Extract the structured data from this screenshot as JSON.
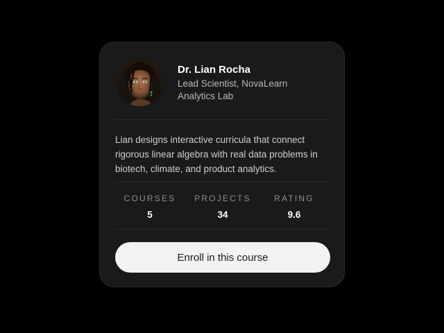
{
  "profile": {
    "name": "Dr. Lian Rocha",
    "role": "Lead Scientist, NovaLearn Analytics Lab",
    "avatar": "avatar-photo"
  },
  "bio": "Lian designs interactive curricula that connect rigorous linear algebra with real data problems in biotech, climate, and product analytics.",
  "stats": [
    {
      "label": "COURSES",
      "value": "5"
    },
    {
      "label": "PROJECTS",
      "value": "34"
    },
    {
      "label": "RATING",
      "value": "9.6"
    }
  ],
  "actions": {
    "enroll_label": "Enroll in this course"
  },
  "colors": {
    "page_background": "#000000",
    "card_background": "#1a1a1a",
    "button_background": "#f2f2f2"
  }
}
